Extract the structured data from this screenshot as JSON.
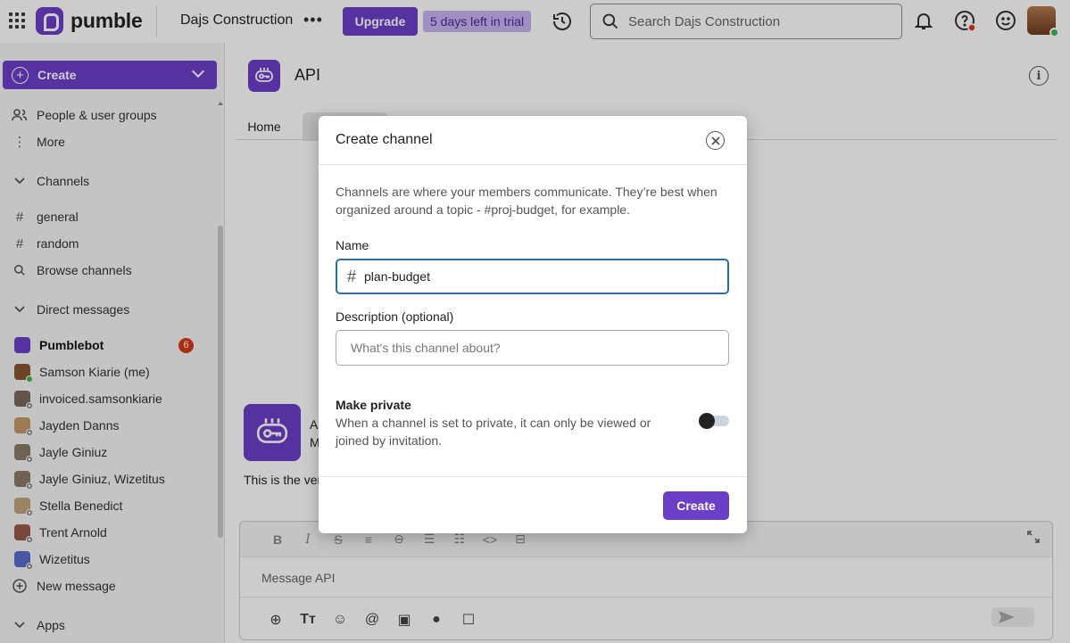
{
  "topbar": {
    "brand": "pumble",
    "workspace": "Dajs Construction",
    "workspace_more": "•••",
    "upgrade_label": "Upgrade",
    "trial_text": "5 days left in trial",
    "search_placeholder": "Search Dajs Construction"
  },
  "sidebar": {
    "create_label": "Create",
    "people": "People & user groups",
    "more": "More",
    "channels_header": "Channels",
    "channels": [
      {
        "label": "general"
      },
      {
        "label": "random"
      }
    ],
    "browse": "Browse channels",
    "dm_header": "Direct messages",
    "dms": [
      {
        "label": "Pumblebot",
        "badge": "6"
      },
      {
        "label": "Samson Kiarie (me)"
      },
      {
        "label": "invoiced.samsonkiarie"
      },
      {
        "label": "Jayden Danns"
      },
      {
        "label": "Jayle Giniuz"
      },
      {
        "label": "Jayle Giniuz, Wizetitus"
      },
      {
        "label": "Stella Benedict"
      },
      {
        "label": "Trent Arnold"
      },
      {
        "label": "Wizetitus"
      }
    ],
    "new_message": "New message",
    "apps_header": "Apps"
  },
  "main": {
    "channel_title": "API",
    "tabs": [
      {
        "label": "Home"
      },
      {
        "label": ""
      }
    ],
    "intro_line1": "A",
    "intro_line2": "M",
    "intro_text": "This is the ver",
    "composer_placeholder": "Message API"
  },
  "modal": {
    "title": "Create channel",
    "description": "Channels are where your members communicate. They’re best when organized around a topic - #proj-budget, for example.",
    "name_label": "Name",
    "name_value": "plan-budget",
    "desc_label": "Description (optional)",
    "desc_placeholder": "What's this channel about?",
    "private_label": "Make private",
    "private_help": "When a channel is set to private, it can only be viewed or joined by invitation.",
    "private_enabled": false,
    "create_label": "Create"
  },
  "colors": {
    "brand": "#6b3fc8",
    "trial_bg": "#c9b3f2",
    "focus_border": "#2b6fa0",
    "notification_badge": "#d93b18",
    "online": "#3fb950"
  }
}
